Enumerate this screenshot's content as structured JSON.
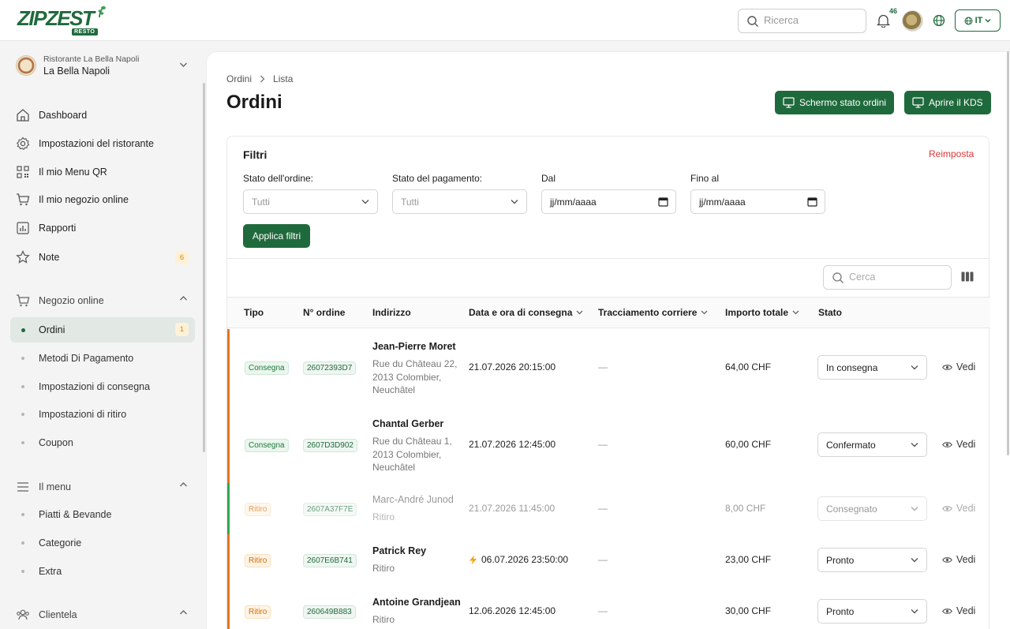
{
  "app": {
    "logo_text": "ZIPZEST",
    "logo_badge": "RESTO",
    "search_placeholder": "Ricerca",
    "notifications_count": "46",
    "language": "IT"
  },
  "sidebar": {
    "restaurant_sub": "Ristorante La Bella Napoli",
    "restaurant_name": "La Bella Napoli",
    "items": [
      {
        "label": "Dashboard",
        "icon": "home-icon"
      },
      {
        "label": "Impostazioni del ristorante",
        "icon": "gear-icon"
      },
      {
        "label": "Il mio Menu QR",
        "icon": "qr-icon"
      },
      {
        "label": "Il mio negozio online",
        "icon": "cart-icon"
      },
      {
        "label": "Rapporti",
        "icon": "chart-icon"
      },
      {
        "label": "Note",
        "icon": "star-icon",
        "badge": "6"
      }
    ],
    "sections": {
      "shop": {
        "label": "Negozio online",
        "items": [
          {
            "label": "Ordini",
            "badge": "1",
            "active": true
          },
          {
            "label": "Metodi Di Pagamento"
          },
          {
            "label": "Impostazioni di consegna"
          },
          {
            "label": "Impostazioni di ritiro"
          },
          {
            "label": "Coupon"
          }
        ]
      },
      "menu": {
        "label": "Il menu",
        "items": [
          {
            "label": "Piatti & Bevande"
          },
          {
            "label": "Categorie"
          },
          {
            "label": "Extra"
          }
        ]
      },
      "clients": {
        "label": "Clientela"
      }
    }
  },
  "main": {
    "breadcrumb": [
      "Ordini",
      "Lista"
    ],
    "title": "Ordini",
    "btn_status_screen": "Schermo stato ordini",
    "btn_kds": "Aprire il KDS",
    "filters": {
      "title": "Filtri",
      "reset": "Reimposta",
      "order_status_label": "Stato dell'ordine:",
      "order_status_value": "Tutti",
      "payment_status_label": "Stato del pagamento:",
      "payment_status_value": "Tutti",
      "from_label": "Dal",
      "from_value": "jj/mm/aaaa",
      "to_label": "Fino al",
      "to_value": "jj/mm/aaaa",
      "apply": "Applica filtri"
    },
    "table": {
      "search_placeholder": "Cerca",
      "headers": [
        "Tipo",
        "N° ordine",
        "Indirizzo",
        "Data e ora di consegna",
        "Tracciamento corriere",
        "Importo totale",
        "Stato"
      ],
      "view_label": "Vedi",
      "rows": [
        {
          "type": "Consegna",
          "order": "26072393D7",
          "name": "Jean-Pierre Moret",
          "address": "Rue du Château 22, 2013 Colombier, Neuchâtel",
          "datetime": "21.07.2026 20:15:00",
          "courier": "—",
          "total": "64,00 CHF",
          "status": "In consegna",
          "accent": "#e8741e"
        },
        {
          "type": "Consegna",
          "order": "2607D3D902",
          "name": "Chantal Gerber",
          "address": "Rue du Château 1, 2013 Colombier, Neuchâtel",
          "datetime": "21.07.2026 12:45:00",
          "courier": "—",
          "total": "60,00 CHF",
          "status": "Confermato",
          "accent": "#e8741e"
        },
        {
          "type": "Ritiro",
          "order": "2607A37F7E",
          "name": "Marc-André Junod",
          "address": "Ritiro",
          "datetime": "21.07.2026 11:45:00",
          "courier": "—",
          "total": "8,00 CHF",
          "status": "Consegnato",
          "accent": "#2fa84f"
        },
        {
          "type": "Ritiro",
          "order": "2607E6B741",
          "name": "Patrick Rey",
          "address": "Ritiro",
          "datetime": "06.07.2026 23:50:00",
          "courier": "—",
          "total": "23,00 CHF",
          "status": "Pronto",
          "accent": "#e8741e"
        },
        {
          "type": "Ritiro",
          "order": "260649B883",
          "name": "Antoine Grandjean",
          "address": "Ritiro",
          "datetime": "12.06.2026 12:45:00",
          "courier": "—",
          "total": "30,00 CHF",
          "status": "Pronto",
          "accent": "#e8741e"
        }
      ]
    }
  }
}
